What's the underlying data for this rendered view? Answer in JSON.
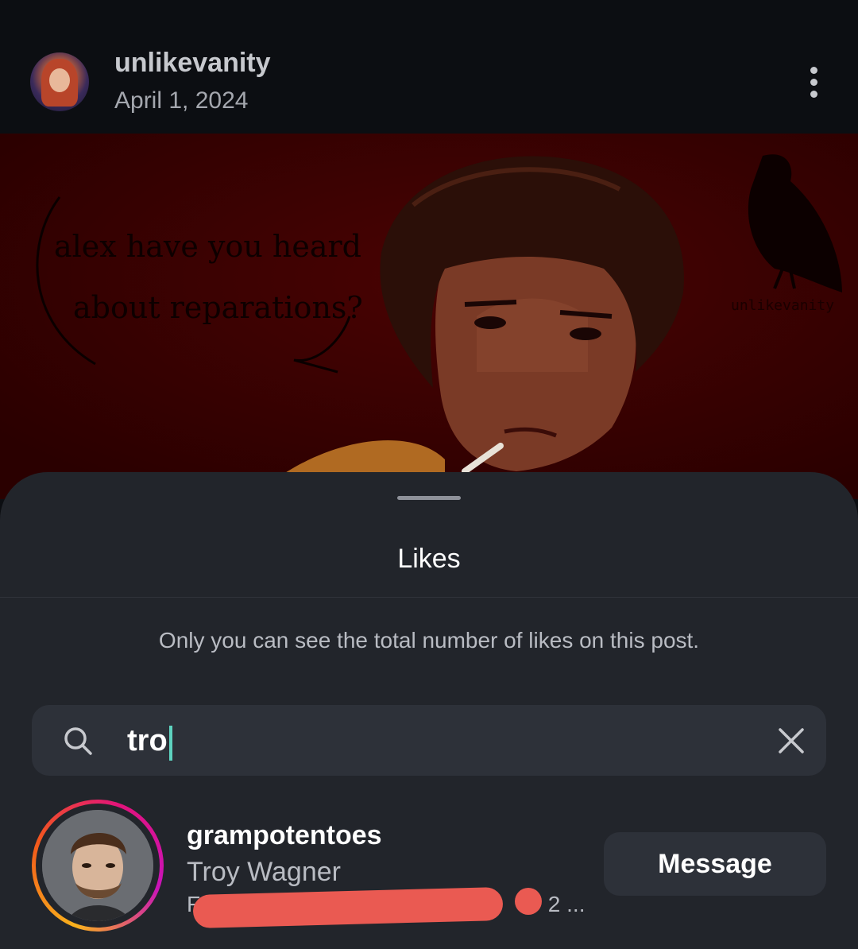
{
  "post": {
    "username": "unlikevanity",
    "date": "April 1, 2024",
    "artwork": {
      "speech_line1": "alex have you heard",
      "speech_line2": "about reparations?",
      "signature": "unlikevanity"
    }
  },
  "likes_sheet": {
    "title": "Likes",
    "privacy_note": "Only you can see the total number of likes on this post.",
    "search": {
      "value": "tro"
    },
    "results": [
      {
        "username": "grampotentoes",
        "full_name": "Troy Wagner",
        "meta_prefix": "F",
        "meta_suffix": "+ 2 ...",
        "button_label": "Message"
      }
    ]
  },
  "colors": {
    "background": "#0c0e12",
    "sheet": "#22252b",
    "field": "#2d3139",
    "artwork_red": "#3d0000",
    "caret": "#5ed3c0",
    "redaction": "#ea5a52"
  },
  "icons": [
    "more-vertical-icon",
    "search-icon",
    "close-icon"
  ]
}
